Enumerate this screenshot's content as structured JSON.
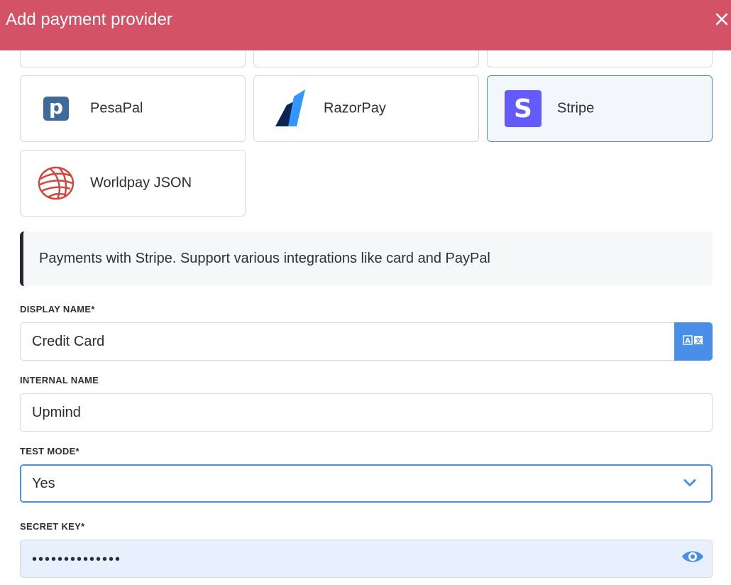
{
  "modal": {
    "title": "Add payment provider"
  },
  "providers": [
    {
      "name": "PesaPal",
      "logo_icon": "pesapal-logo",
      "logo_text": "p",
      "selected": false
    },
    {
      "name": "RazorPay",
      "logo_icon": "razorpay-logo",
      "selected": false
    },
    {
      "name": "Stripe",
      "logo_icon": "stripe-logo",
      "logo_text": "S",
      "selected": true
    },
    {
      "name": "Worldpay JSON",
      "logo_icon": "worldpay-logo",
      "selected": false
    }
  ],
  "description": "Payments with Stripe. Support various integrations like card and PayPal",
  "form": {
    "display_name": {
      "label": "DISPLAY NAME*",
      "value": "Credit Card",
      "translate_icon": "translate-icon"
    },
    "internal_name": {
      "label": "INTERNAL NAME",
      "value": "Upmind"
    },
    "test_mode": {
      "label": "TEST MODE*",
      "value": "Yes"
    },
    "secret_key": {
      "label": "SECRET KEY*",
      "masked_value": "••••••••••••••"
    }
  },
  "colors": {
    "header": "#d35266",
    "accent": "#4a90e2",
    "stripe": "#635bff",
    "pesapal": "#3e6a9c",
    "worldpay": "#d1453b"
  }
}
